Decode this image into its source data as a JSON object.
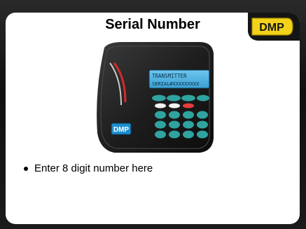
{
  "slide": {
    "title": "Serial Number",
    "bullets": [
      "Enter 8 digit number here"
    ]
  },
  "logo": {
    "text": "DMP",
    "color": "#f2d21b"
  },
  "keypad": {
    "lcd_line1": "TRANSMITTER",
    "lcd_line2": "SERIAL#XXXXXXXXX",
    "lcd_color": "#4fb6e6",
    "badge_text": "DMP",
    "key_color": "#2fa3a0"
  }
}
